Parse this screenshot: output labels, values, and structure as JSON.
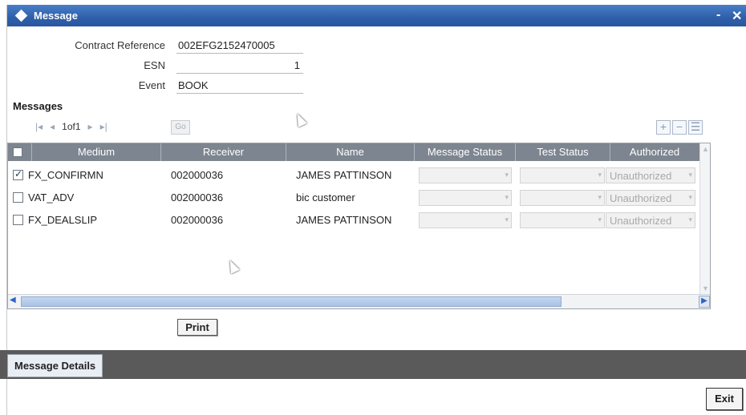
{
  "window": {
    "title": "Message",
    "minimize_label": "-",
    "close_label": "✕"
  },
  "header": {
    "contract_reference": {
      "label": "Contract Reference",
      "value": "002EFG2152470005"
    },
    "esn": {
      "label": "ESN",
      "value": "1"
    },
    "event": {
      "label": "Event",
      "value": "BOOK"
    }
  },
  "messages": {
    "heading": "Messages",
    "pager": {
      "first": "|◂",
      "prev": "◂",
      "page_text": "1of1",
      "next": "▸",
      "last": "▸|",
      "go_label": "Go"
    },
    "tools": {
      "add": "+",
      "remove": "−",
      "view": "☰"
    },
    "columns": [
      "Medium",
      "Receiver",
      "Name",
      "Message Status",
      "Test Status",
      "Authorized"
    ],
    "rows": [
      {
        "checked": true,
        "medium": "FX_CONFIRMN",
        "receiver": "002000036",
        "name": "JAMES PATTINSON",
        "message_status": "",
        "test_status": "",
        "authorized": "Unauthorized"
      },
      {
        "checked": false,
        "medium": "VAT_ADV",
        "receiver": "002000036",
        "name": "bic customer",
        "message_status": "",
        "test_status": "",
        "authorized": "Unauthorized"
      },
      {
        "checked": false,
        "medium": "FX_DEALSLIP",
        "receiver": "002000036",
        "name": "JAMES PATTINSON",
        "message_status": "",
        "test_status": "",
        "authorized": "Unauthorized"
      }
    ]
  },
  "actions": {
    "print_label": "Print",
    "exit_label": "Exit"
  },
  "tabs": {
    "message_details": "Message Details"
  },
  "colors": {
    "title_bar": "#2f5fa8",
    "grid_header": "#7d8590",
    "band": "#5a5a5a"
  }
}
